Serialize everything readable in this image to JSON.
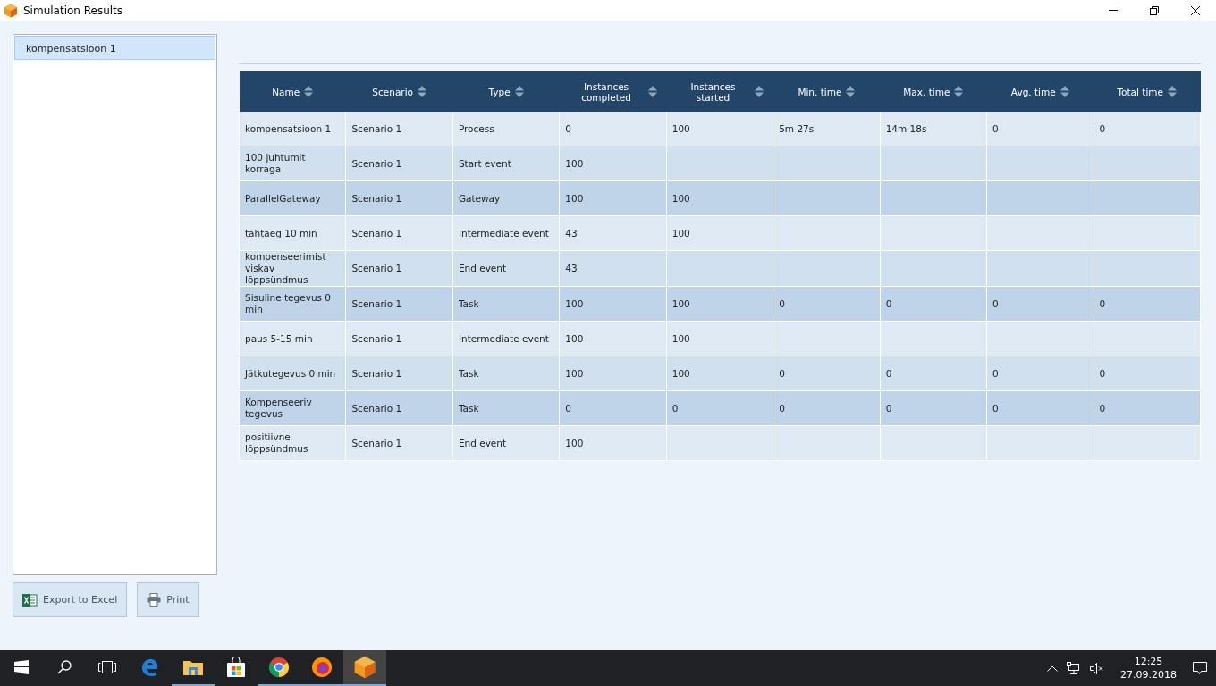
{
  "window": {
    "title": "Simulation Results"
  },
  "sidebar": {
    "items": [
      {
        "label": "kompensatsioon 1",
        "selected": true
      }
    ]
  },
  "buttons": [
    {
      "kind": "excel",
      "label": "Export to Excel"
    },
    {
      "kind": "print",
      "label": "Print"
    }
  ],
  "table": {
    "columns": [
      "Name",
      "Scenario",
      "Type",
      "Instances completed",
      "Instances started",
      "Min. time",
      "Max. time",
      "Avg. time",
      "Total time"
    ],
    "rows": [
      [
        "kompensatsioon 1",
        "Scenario 1",
        "Process",
        "0",
        "100",
        "5m 27s",
        "14m 18s",
        "0",
        "0"
      ],
      [
        "100 juhtumit korraga",
        "Scenario 1",
        "Start event",
        "100",
        "",
        "",
        "",
        "",
        ""
      ],
      [
        "ParallelGateway",
        "Scenario 1",
        "Gateway",
        "100",
        "100",
        "",
        "",
        "",
        ""
      ],
      [
        "tähtaeg 10 min",
        "Scenario 1",
        "Intermediate event",
        "43",
        "100",
        "",
        "",
        "",
        ""
      ],
      [
        "kompenseerimist viskav lõppsündmus",
        "Scenario 1",
        "End event",
        "43",
        "",
        "",
        "",
        "",
        ""
      ],
      [
        "Sisuline tegevus 0 min",
        "Scenario 1",
        "Task",
        "100",
        "100",
        "0",
        "0",
        "0",
        "0"
      ],
      [
        "paus 5-15 min",
        "Scenario 1",
        "Intermediate event",
        "100",
        "100",
        "",
        "",
        "",
        ""
      ],
      [
        "Jätkutegevus 0 min",
        "Scenario 1",
        "Task",
        "100",
        "100",
        "0",
        "0",
        "0",
        "0"
      ],
      [
        "Kompenseeriv tegevus",
        "Scenario 1",
        "Task",
        "0",
        "0",
        "0",
        "0",
        "0",
        "0"
      ],
      [
        "positiivne lõppsündmus",
        "Scenario 1",
        "End event",
        "100",
        "",
        "",
        "",
        "",
        ""
      ]
    ]
  },
  "taskbar": {
    "apps": [
      {
        "kind": "start",
        "running": false,
        "selected": false
      },
      {
        "kind": "search",
        "running": false,
        "selected": false
      },
      {
        "kind": "taskview",
        "running": false,
        "selected": false
      },
      {
        "kind": "edge",
        "running": false,
        "selected": false
      },
      {
        "kind": "explorer",
        "running": true,
        "selected": false
      },
      {
        "kind": "store",
        "running": false,
        "selected": false
      },
      {
        "kind": "chrome",
        "running": true,
        "selected": false
      },
      {
        "kind": "firefox",
        "running": true,
        "selected": false
      },
      {
        "kind": "app",
        "running": true,
        "selected": true
      }
    ],
    "time": "12:25",
    "date": "27.09.2018"
  }
}
